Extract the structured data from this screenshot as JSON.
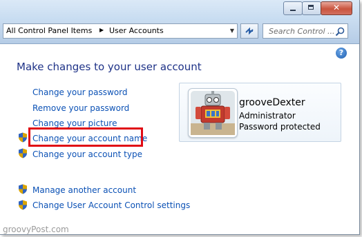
{
  "navigation": {
    "breadcrumb": [
      "All Control Panel Items",
      "User Accounts"
    ],
    "search_placeholder": "Search Control ..."
  },
  "page": {
    "heading": "Make changes to your user account",
    "tasks": [
      {
        "label": "Change your password",
        "shield": false
      },
      {
        "label": "Remove your password",
        "shield": false
      },
      {
        "label": "Change your picture",
        "shield": false
      },
      {
        "label": "Change your account name",
        "shield": true,
        "highlighted": true
      },
      {
        "label": "Change your account type",
        "shield": true
      }
    ],
    "other_tasks": [
      {
        "label": "Manage another account",
        "shield": true
      },
      {
        "label": "Change User Account Control settings",
        "shield": true
      }
    ]
  },
  "account": {
    "name": "grooveDexter",
    "type": "Administrator",
    "status": "Password protected"
  },
  "watermark": "groovyPost.com",
  "colors": {
    "link": "#0b51b5",
    "heading": "#1e3287",
    "highlight": "#e00a14"
  }
}
